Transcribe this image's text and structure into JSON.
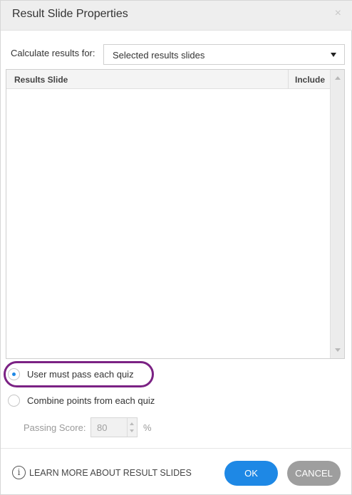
{
  "dialog": {
    "title": "Result Slide Properties",
    "close_glyph": "×"
  },
  "calculate": {
    "label": "Calculate results for:",
    "selected": "Selected results slides"
  },
  "table": {
    "columns": [
      "Results Slide",
      "Include"
    ],
    "rows": []
  },
  "options": {
    "pass_each": "User must pass each quiz",
    "combine": "Combine points from each quiz",
    "selected": "pass_each"
  },
  "passing": {
    "label": "Passing Score:",
    "value": "80",
    "unit": "%"
  },
  "footer": {
    "learn_more": "LEARN MORE ABOUT RESULT SLIDES",
    "ok": "OK",
    "cancel": "CANCEL"
  },
  "colors": {
    "accent": "#1e88e5",
    "cancel": "#9e9e9e",
    "highlight": "#7b2284"
  },
  "icons": {
    "close": "close-icon",
    "dropdown": "chevron-down-icon",
    "info": "info-icon"
  }
}
